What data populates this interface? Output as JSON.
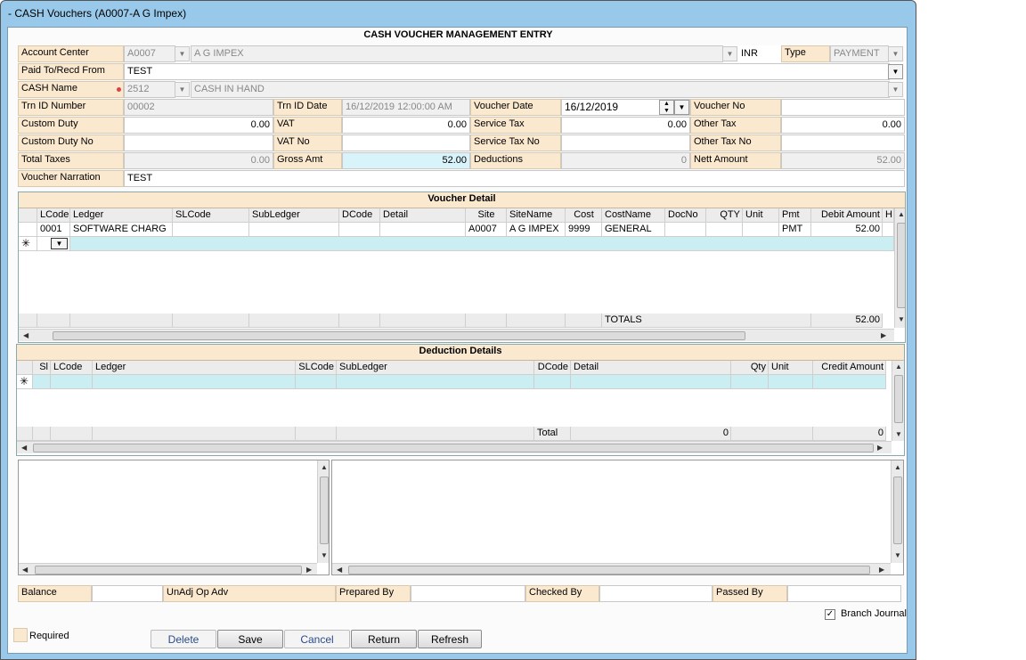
{
  "window": {
    "title": "- CASH Vouchers   (A0007-A G Impex)"
  },
  "header": {
    "title": "CASH VOUCHER MANAGEMENT ENTRY"
  },
  "form": {
    "account_center_label": "Account Center",
    "account_center_code": "A0007",
    "account_center_name": "A G IMPEX",
    "currency": "INR",
    "type_label": "Type",
    "type_value": "PAYMENT",
    "paid_to_label": "Paid To/Recd From",
    "paid_to_value": "TEST",
    "cash_name_label": "CASH Name",
    "cash_code": "2512",
    "cash_name_value": "CASH IN HAND",
    "trn_id_label": "Trn ID Number",
    "trn_id_value": "00002",
    "trn_date_label": "Trn ID Date",
    "trn_date_value": "16/12/2019 12:00:00 AM",
    "voucher_date_label": "Voucher Date",
    "voucher_date_value": "16/12/2019",
    "voucher_no_label": "Voucher No",
    "voucher_no_value": "",
    "custom_duty_label": "Custom Duty",
    "custom_duty_value": "0.00",
    "vat_label": "VAT",
    "vat_value": "0.00",
    "service_tax_label": "Service Tax",
    "service_tax_value": "0.00",
    "other_tax_label": "Other Tax",
    "other_tax_value": "0.00",
    "custom_duty_no_label": "Custom Duty No",
    "vat_no_label": "VAT No",
    "service_tax_no_label": "Service Tax No",
    "other_tax_no_label": "Other Tax No",
    "total_taxes_label": "Total Taxes",
    "total_taxes_value": "0.00",
    "gross_amt_label": "Gross Amt",
    "gross_amt_value": "52.00",
    "deductions_label": "Deductions",
    "deductions_value": "0",
    "nett_amount_label": "Nett Amount",
    "nett_amount_value": "52.00",
    "narration_label": "Voucher Narration",
    "narration_value": "TEST"
  },
  "voucher_detail": {
    "title": "Voucher Detail",
    "columns": [
      "LCode",
      "Ledger",
      "SLCode",
      "SubLedger",
      "DCode",
      "Detail",
      "Site",
      "SiteName",
      "Cost",
      "CostName",
      "DocNo",
      "QTY",
      "Unit",
      "Pmt",
      "Debit Amount",
      "H"
    ],
    "rows": [
      [
        "0001",
        "SOFTWARE CHARG",
        "",
        "",
        "",
        "",
        "A0007",
        "A G IMPEX",
        "9999",
        "GENERAL",
        "",
        "",
        "",
        "PMT",
        "52.00",
        ""
      ]
    ],
    "new_row_marker": "✳",
    "totals_label": "TOTALS",
    "totals_value": "52.00"
  },
  "deduction_details": {
    "title": "Deduction Details",
    "columns": [
      "Sl",
      "LCode",
      "Ledger",
      "SLCode",
      "SubLedger",
      "DCode",
      "Detail",
      "Qty",
      "Unit",
      "Credit Amount"
    ],
    "new_row_marker": "✳",
    "total_label": "Total",
    "total_qty": "0",
    "total_credit": "0"
  },
  "footer": {
    "balance_label": "Balance",
    "unadj_label": "UnAdj Op Adv",
    "prepared_label": "Prepared By",
    "checked_label": "Checked By",
    "passed_label": "Passed By",
    "branch_journal_label": "Branch Journal",
    "required_label": "Required"
  },
  "buttons": {
    "delete": "Delete",
    "save": "Save",
    "cancel": "Cancel",
    "return": "Return",
    "refresh": "Refresh"
  },
  "colors": {
    "frame": "#99c9ea",
    "label_bg": "#fbe9cf",
    "new_row": "#cbeef2"
  }
}
